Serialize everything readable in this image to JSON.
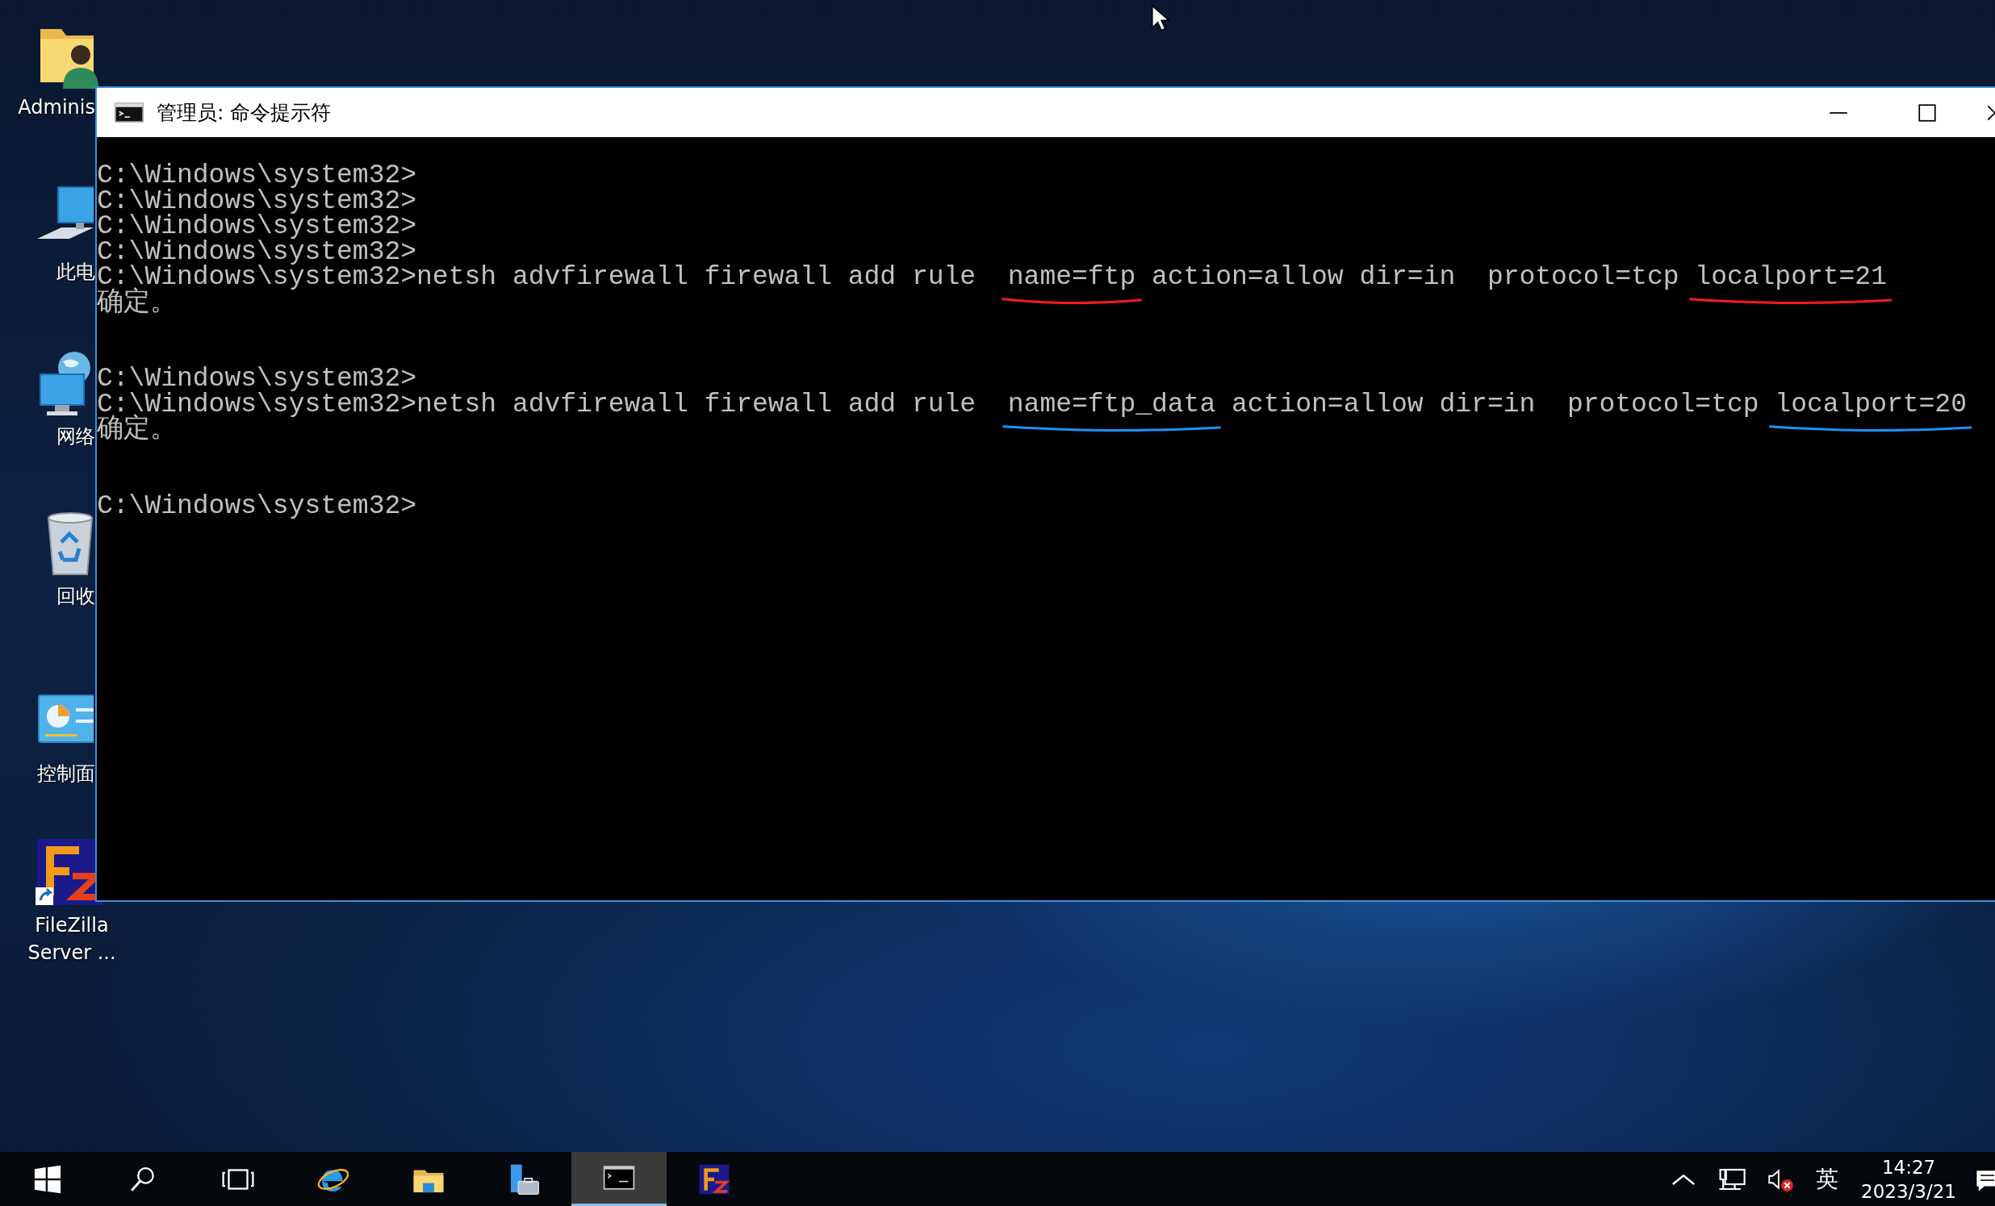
{
  "desktop_icons": [
    {
      "label": "Adminis",
      "kind": "user_folder"
    },
    {
      "label": "此电",
      "kind": "computer"
    },
    {
      "label": "网络",
      "kind": "network"
    },
    {
      "label": "回收",
      "kind": "recycle_bin"
    },
    {
      "label": "控制面",
      "kind": "control_panel"
    },
    {
      "label": "FileZilla Server ...",
      "kind": "ftp_server"
    }
  ],
  "window": {
    "title": "管理员: 命令提示符",
    "terminal": {
      "lines": [
        {
          "kind": "prompt",
          "segments": [
            {
              "text": "C:\\Windows\\system32>"
            }
          ]
        },
        {
          "kind": "prompt",
          "segments": [
            {
              "text": "C:\\Windows\\system32>"
            }
          ]
        },
        {
          "kind": "prompt",
          "segments": [
            {
              "text": "C:\\Windows\\system32>"
            }
          ]
        },
        {
          "kind": "prompt",
          "segments": [
            {
              "text": "C:\\Windows\\system32>"
            }
          ]
        },
        {
          "kind": "prompt",
          "segments": [
            {
              "text": "C:\\Windows\\system32>netsh advfirewall firewall add rule  "
            },
            {
              "text": "name=ftp",
              "color": "#ff1a1a"
            },
            {
              "text": " action=allow dir=in  protocol=tcp "
            },
            {
              "text": "localport=21",
              "color": "#ff1a1a"
            }
          ]
        },
        {
          "kind": "output",
          "segments": [
            {
              "text": "确定。"
            }
          ]
        },
        {
          "kind": "prompt",
          "segments": [
            {
              "text": "C:\\Windows\\system32>"
            }
          ]
        },
        {
          "kind": "prompt",
          "segments": [
            {
              "text": "C:\\Windows\\system32>netsh advfirewall firewall add rule  "
            },
            {
              "text": "name=ftp_data",
              "color": "#1e90ff"
            },
            {
              "text": " action=allow dir=in  protocol=tcp "
            },
            {
              "text": "localport=20",
              "color": "#1e90ff"
            }
          ]
        },
        {
          "kind": "output",
          "segments": [
            {
              "text": "确定。"
            }
          ]
        },
        {
          "kind": "prompt",
          "segments": [
            {
              "text": "C:\\Windows\\system32>"
            }
          ]
        }
      ]
    }
  },
  "taskbar": {
    "apps": [
      {
        "kind": "start",
        "selected": false
      },
      {
        "kind": "search",
        "selected": false
      },
      {
        "kind": "task_view",
        "selected": false
      },
      {
        "kind": "browser",
        "selected": false
      },
      {
        "kind": "folder",
        "selected": false
      },
      {
        "kind": "server",
        "selected": false
      },
      {
        "kind": "terminal",
        "selected": true
      },
      {
        "kind": "ftp",
        "selected": false
      }
    ],
    "tray": {
      "input_method": "英",
      "time": "14:27",
      "date": "2023/3/21",
      "volume_muted": true
    }
  }
}
